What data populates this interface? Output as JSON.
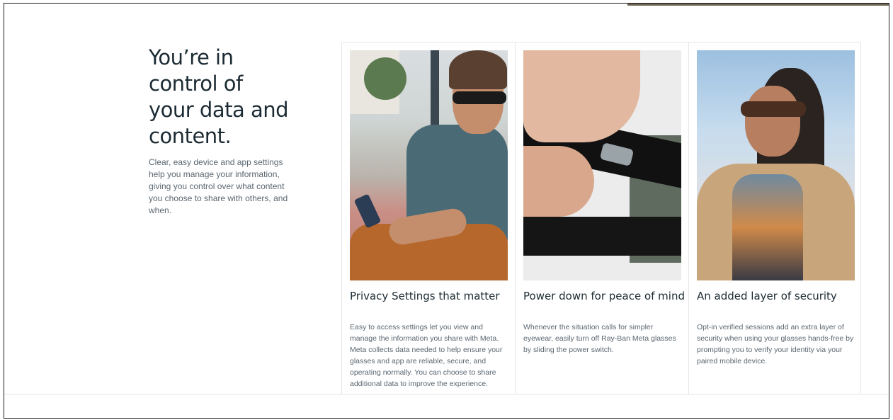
{
  "intro": {
    "title": "You’re in control of your data and content.",
    "body": "Clear, easy device and app settings help you manage your information, giving you control over what content you choose to share with others, and when."
  },
  "cards": [
    {
      "title": "Privacy Settings that matter",
      "body": "Easy to access settings let you view and manage the information you share with Meta. Meta collects data needed to help ensure your glasses and app are reliable, secure, and operating normally. You can choose to share additional data to improve the experience."
    },
    {
      "title": "Power down for peace of mind",
      "body": "Whenever the situation calls for simpler eyewear, easily turn off Ray-Ban Meta glasses by sliding the power switch."
    },
    {
      "title": "An added layer of security",
      "body": "Opt-in verified sessions add an extra layer of security when using your glasses hands-free by prompting you to verify your identity via your paired mobile device."
    }
  ],
  "colors": {
    "heading": "#1c2b33",
    "body": "#5a6670",
    "divider": "#e4e6ea"
  }
}
